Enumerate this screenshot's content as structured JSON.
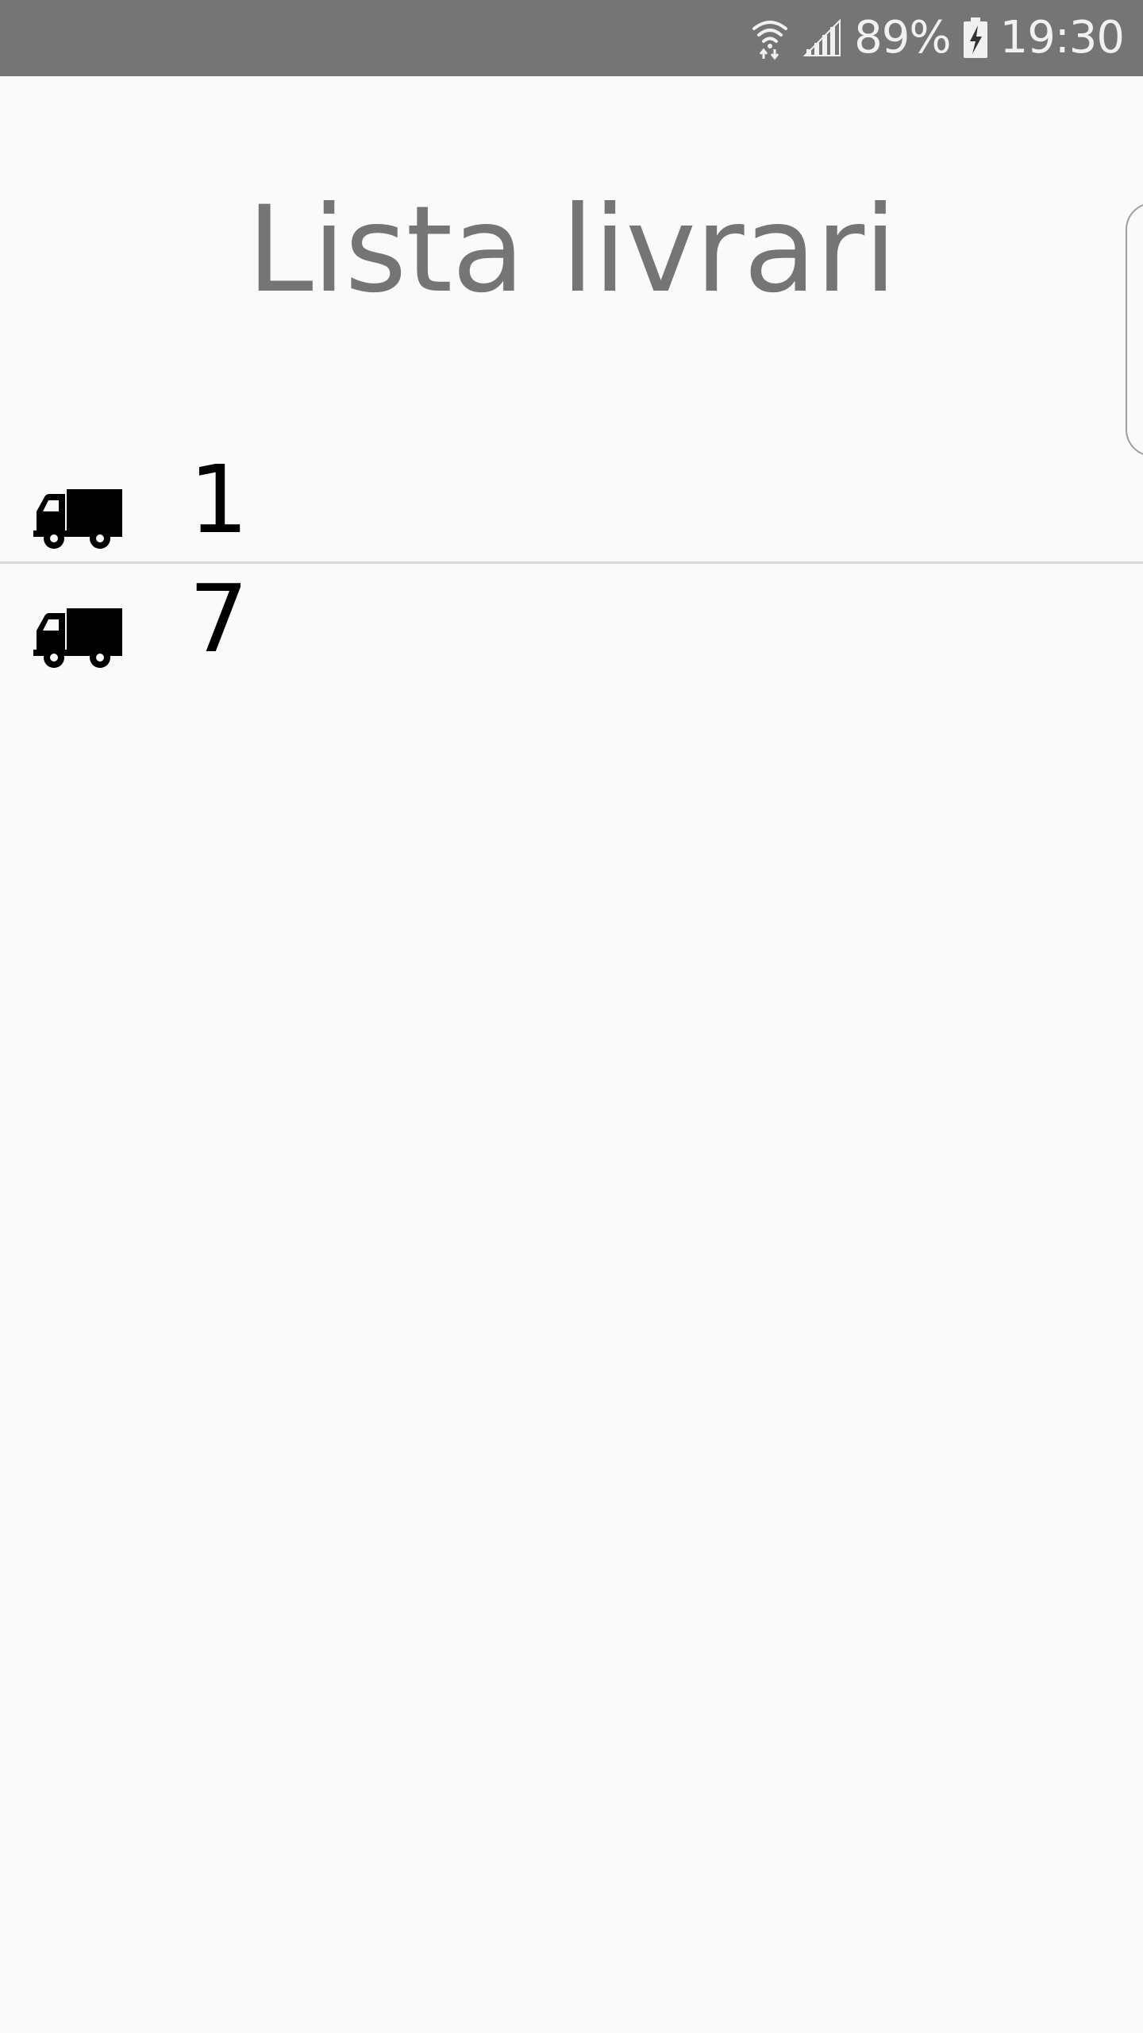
{
  "status_bar": {
    "battery_percent": "89%",
    "time": "19:30",
    "icons": [
      "wifi-icon",
      "signal-icon",
      "battery-charging-icon"
    ]
  },
  "header": {
    "title": "Lista livrari"
  },
  "deliveries": [
    {
      "icon": "truck-icon",
      "number": "1"
    },
    {
      "icon": "truck-icon",
      "number": "7"
    }
  ],
  "colors": {
    "status_bar_bg": "#757575",
    "background": "#fafafa",
    "title": "#757575",
    "divider": "#d9d9d9"
  }
}
